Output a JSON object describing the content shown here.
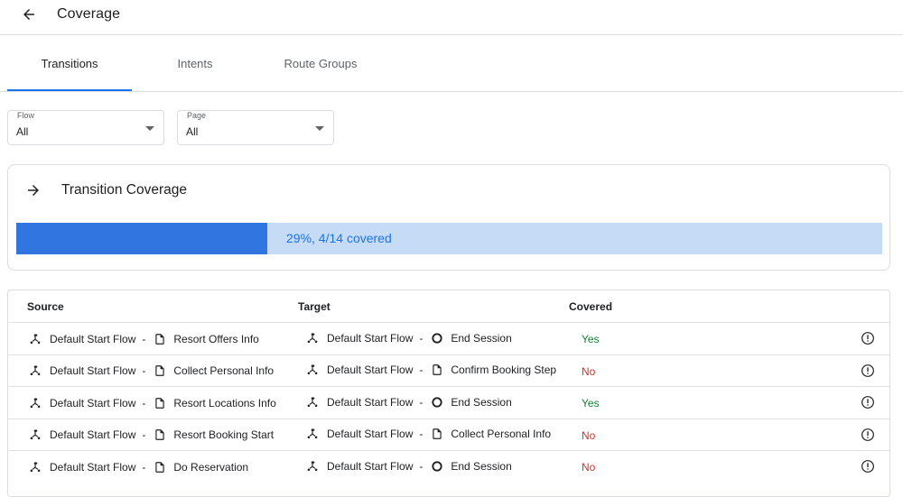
{
  "header": {
    "title": "Coverage",
    "back_icon": "arrow-back-icon"
  },
  "tabs": [
    {
      "label": "Transitions",
      "active": true
    },
    {
      "label": "Intents",
      "active": false
    },
    {
      "label": "Route Groups",
      "active": false
    }
  ],
  "filters": {
    "flow": {
      "label": "Flow",
      "value": "All"
    },
    "page": {
      "label": "Page",
      "value": "All"
    }
  },
  "coverage": {
    "title": "Transition Coverage",
    "icon": "arrow-forward-icon",
    "progress_fraction": 0.29,
    "summary": "29%, 4/14 covered"
  },
  "table": {
    "headers": {
      "source": "Source",
      "target": "Target",
      "covered": "Covered"
    },
    "rows": [
      {
        "source_flow": "Default Start Flow",
        "source_page": "Resort Offers Info",
        "target_flow": "Default Start Flow",
        "target_page": "End Session",
        "target_icon": "end-session-icon",
        "covered": "Yes"
      },
      {
        "source_flow": "Default Start Flow",
        "source_page": "Collect Personal Info",
        "target_flow": "Default Start Flow",
        "target_page": "Confirm Booking Step",
        "target_icon": "page-icon",
        "covered": "No"
      },
      {
        "source_flow": "Default Start Flow",
        "source_page": "Resort Locations Info",
        "target_flow": "Default Start Flow",
        "target_page": "End Session",
        "target_icon": "end-session-icon",
        "covered": "Yes"
      },
      {
        "source_flow": "Default Start Flow",
        "source_page": "Resort Booking Start",
        "target_flow": "Default Start Flow",
        "target_page": "Collect Personal Info",
        "target_icon": "page-icon",
        "covered": "No"
      },
      {
        "source_flow": "Default Start Flow",
        "source_page": "Do Reservation",
        "target_flow": "Default Start Flow",
        "target_page": "End Session",
        "target_icon": "end-session-icon",
        "covered": "No"
      }
    ]
  },
  "colors": {
    "accent": "#1a73e8",
    "progress_fill": "#3176e0",
    "progress_track": "#c6dbf6",
    "yes": "#188038",
    "no": "#d93025"
  }
}
